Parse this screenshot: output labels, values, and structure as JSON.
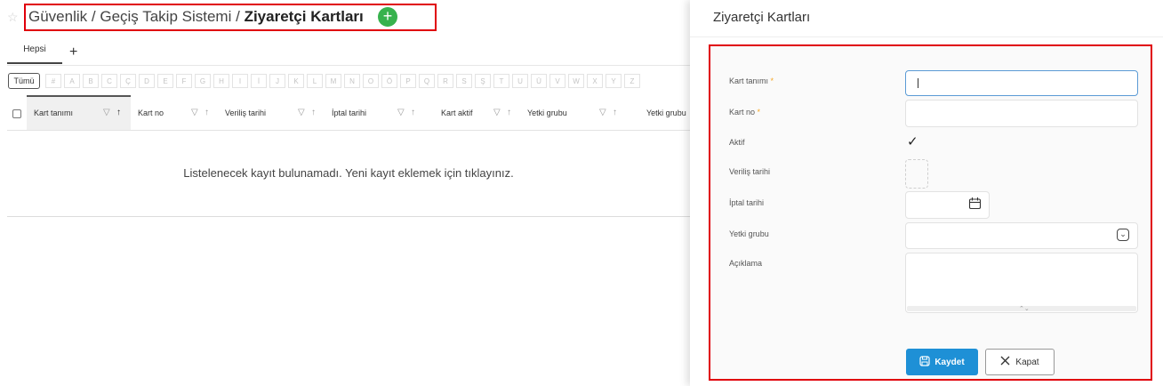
{
  "breadcrumb": {
    "part1": "Güvenlik",
    "sep": "/",
    "part2": "Geçiş Takip Sistemi",
    "current": "Ziyaretçi Kartları"
  },
  "add_icon": "plus-circle-icon",
  "tabs": [
    {
      "label": "Hepsi"
    }
  ],
  "tab_add_label": "+",
  "alphabet": {
    "all_label": "Tümü",
    "letters": [
      "#",
      "A",
      "B",
      "C",
      "Ç",
      "D",
      "E",
      "F",
      "G",
      "H",
      "I",
      "İ",
      "J",
      "K",
      "L",
      "M",
      "N",
      "O",
      "Ö",
      "P",
      "Q",
      "R",
      "S",
      "Ş",
      "T",
      "U",
      "Ü",
      "V",
      "W",
      "X",
      "Y",
      "Z"
    ]
  },
  "table": {
    "columns": [
      "Kart tanımı",
      "Kart no",
      "Veriliş tarihi",
      "İptal tarihi",
      "Kart aktif",
      "Yetki grubu",
      "Yetki grubu"
    ],
    "sort_active": "↑",
    "sort_inactive": "↑",
    "filter_glyph": "▽",
    "empty_message": "Listelenecek kayıt bulunamadı. Yeni kayıt eklemek için tıklayınız."
  },
  "panel": {
    "title": "Ziyaretçi Kartları",
    "fields": {
      "kart_tanimi": {
        "label": "Kart tanımı",
        "required": "*",
        "value": ""
      },
      "kart_no": {
        "label": "Kart no",
        "required": "*",
        "value": ""
      },
      "aktif": {
        "label": "Aktif",
        "checked": true
      },
      "verilis_tarihi": {
        "label": "Veriliş tarihi"
      },
      "iptal_tarihi": {
        "label": "İptal tarihi"
      },
      "yetki_grubu": {
        "label": "Yetki grubu"
      },
      "aciklama": {
        "label": "Açıklama"
      }
    },
    "save_label": "Kaydet",
    "close_label": "Kapat"
  },
  "colors": {
    "accent": "#1e90d6",
    "add_green": "#37b24d",
    "highlight": "#e0000a",
    "required": "#f5a623"
  }
}
